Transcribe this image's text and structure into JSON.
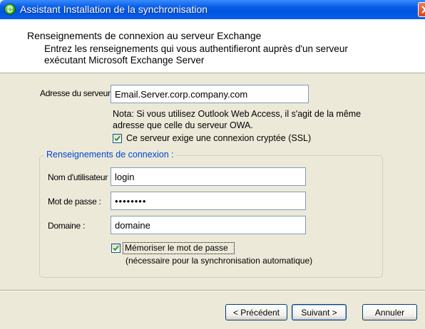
{
  "window": {
    "title": "Assistant Installation de la synchronisation",
    "icon": "sync-app-icon",
    "close_icon": "close-icon"
  },
  "header": {
    "title": "Renseignements de connexion au serveur Exchange",
    "description": "Entrez les renseignements qui vous authentifieront auprès d'un serveur exécutant Microsoft Exchange Server"
  },
  "server": {
    "label": "Adresse du serveur :",
    "value": "Email.Server.corp.company.com",
    "note": "Nota: Si vous utilisez Outlook Web Access, il s'agit de la même adresse que celle du serveur OWA.",
    "ssl_label": "Ce serveur exige une connexion cryptée (SSL)",
    "ssl_checked": true
  },
  "credentials": {
    "group_title": "Renseignements de connexion :",
    "username_label": "Nom d'utilisateur :",
    "username_value": "login",
    "password_label": "Mot de passe :",
    "password_value": "••••••••",
    "domain_label": "Domaine :",
    "domain_value": "domaine",
    "remember_label": "Mémoriser le mot de passe",
    "remember_checked": true,
    "remember_hint": "(nécessaire pour la synchronisation automatique)"
  },
  "buttons": {
    "back": "< Précédent",
    "next": "Suivant >",
    "cancel": "Annuler"
  },
  "colors": {
    "titlebar": "#0054e3",
    "window_bg": "#ece9d8",
    "group_title": "#0046d5",
    "field_border": "#7f9db9"
  }
}
